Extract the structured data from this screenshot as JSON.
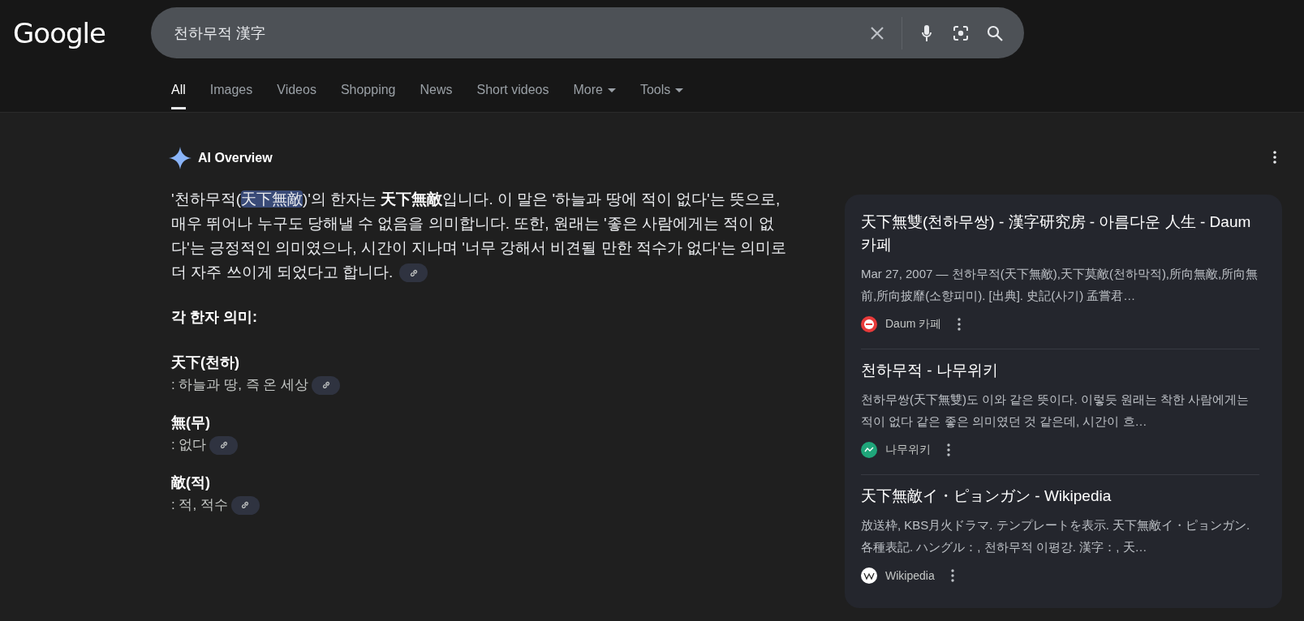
{
  "logo": "Google",
  "search": {
    "value": "천하무적 漢字"
  },
  "tabs": [
    {
      "label": "All",
      "selected": true,
      "dropdown": false
    },
    {
      "label": "Images",
      "selected": false,
      "dropdown": false
    },
    {
      "label": "Videos",
      "selected": false,
      "dropdown": false
    },
    {
      "label": "Shopping",
      "selected": false,
      "dropdown": false
    },
    {
      "label": "News",
      "selected": false,
      "dropdown": false
    },
    {
      "label": "Short videos",
      "selected": false,
      "dropdown": false
    },
    {
      "label": "More",
      "selected": false,
      "dropdown": true
    },
    {
      "label": "Tools",
      "selected": false,
      "dropdown": true
    }
  ],
  "overview": {
    "title": "AI Overview",
    "paragraph": [
      {
        "kind": "plain",
        "text": "'천하무적("
      },
      {
        "kind": "selected",
        "text": "天下無敵"
      },
      {
        "kind": "plain",
        "text": ")'의 한자는 "
      },
      {
        "kind": "bold",
        "text": "天下無敵"
      },
      {
        "kind": "plain",
        "text": "입니다. 이 말은 '하늘과 땅에 적이 없다'는 뜻으로, 매우 뛰어나 누구도 당해낼 수 없음을 의미합니다. 또한, 원래는 '좋은 사람에게는 적이 없다'는 긍정적인 의미였으나, 시간이 지나며 '너무 강해서 비견될 만한 적수가 없다'는 의미로 더 자주 쓰이게 되었다고 합니다."
      }
    ],
    "heading": "각 한자 의미:",
    "meanings": [
      {
        "term": "天下(천하)",
        "definition": ": 하늘과 땅, 즉 온 세상"
      },
      {
        "term": "無(무)",
        "definition": ": 없다"
      },
      {
        "term": "敵(적)",
        "definition": ": 적, 적수"
      }
    ]
  },
  "sources": [
    {
      "title": "天下無雙(천하무쌍) - 漢字研究房 - 아름다운 人生 - Daum 카페",
      "snippet": "Mar 27, 2007 — 천하무적(天下無敵),天下莫敵(천하막적),所向無敵,所向無前,所向披靡(소향피미). [出典]. 史記(사기) 孟嘗君…",
      "site": "Daum 카페",
      "kind": "daum"
    },
    {
      "title": "천하무적 - 나무위키",
      "snippet": "천하무쌍(天下無雙)도 이와 같은 뜻이다. 이렇듯 원래는 착한 사람에게는 적이 없다 같은 좋은 의미였던 것 같은데, 시간이 흐…",
      "site": "나무위키",
      "kind": "namu"
    },
    {
      "title": "天下無敵イ・ピョンガン - Wikipedia",
      "snippet": "放送枠, KBS月火ドラマ. テンプレートを表示. 天下無敵イ・ピョンガン. 各種表記. ハングル：, 천하무적 이평강. 漢字：, 天…",
      "site": "Wikipedia",
      "kind": "wiki"
    }
  ]
}
